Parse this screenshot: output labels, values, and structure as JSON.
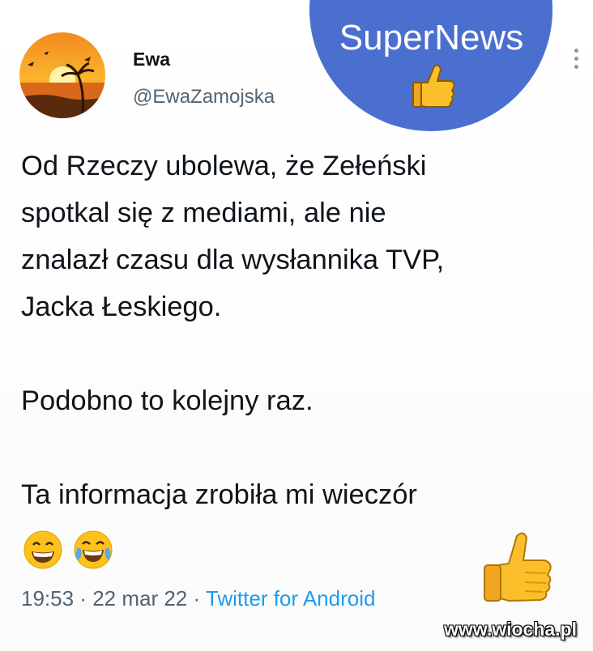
{
  "user": {
    "name": "Ewa",
    "handle": "@EwaZamojska"
  },
  "overlay": {
    "brand": "SuperNews",
    "brand_color": "#4a6fcf"
  },
  "tweet": {
    "lines": [
      "Od Rzeczy ubolewa, że Zełeński",
      "spotkal się z mediami, ale nie",
      "znalazł czasu dla wysłannika TVP,",
      "Jacka Łeskiego.",
      "Podobno to kolejny raz.",
      "Ta informacja zrobiła mi wieczór"
    ],
    "emojis": [
      "grinning-face-icon",
      "tears-of-joy-icon"
    ]
  },
  "meta": {
    "time": "19:53",
    "sep1": " · ",
    "date": "22 mar 22",
    "sep2": " · ",
    "source": "Twitter for Android"
  },
  "watermark": "www.wiocha.pl",
  "colors": {
    "text": "#0f1419",
    "muted": "#536471",
    "link": "#1d9bf0"
  }
}
